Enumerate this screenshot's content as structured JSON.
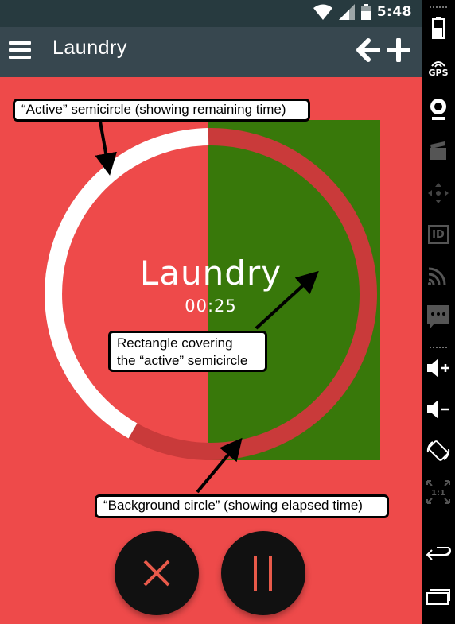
{
  "status_bar": {
    "time": "5:48",
    "icons": [
      "wifi-icon",
      "signal-icon",
      "battery-icon"
    ]
  },
  "app_bar": {
    "title": "Laundry",
    "icons": [
      "menu-icon",
      "arrow-left-icon",
      "plus-icon"
    ]
  },
  "timer": {
    "title": "Laundry",
    "time": "00:25"
  },
  "annotations": {
    "active": "“Active” semicircle (showing remaining time)",
    "rect_line1": "Rectangle covering",
    "rect_line2": "the “active” semicircle",
    "background": "“Background circle” (showing elapsed time)"
  },
  "controls": {
    "cancel_icon": "close-icon",
    "pause_icon": "pause-icon"
  },
  "emulator_sidebar": {
    "gps_label": "GPS",
    "id_label": "ID",
    "ratio_label": "1:1",
    "icons": [
      "battery-icon",
      "gps-icon",
      "webcam-icon",
      "clapperboard-icon",
      "dpad-icon",
      "id-icon",
      "cast-icon",
      "sms-icon",
      "volume-up-icon",
      "volume-down-icon",
      "rotate-icon",
      "scale-icon",
      "back-icon",
      "recents-icon"
    ]
  },
  "colors": {
    "background": "#EE4A4A",
    "ring_active": "#FFFFFF",
    "ring_background": "#C93A3A",
    "rectangle": "#38780A",
    "app_bar": "#37474F",
    "fab": "#111111",
    "fab_icon": "#E85A4A"
  }
}
